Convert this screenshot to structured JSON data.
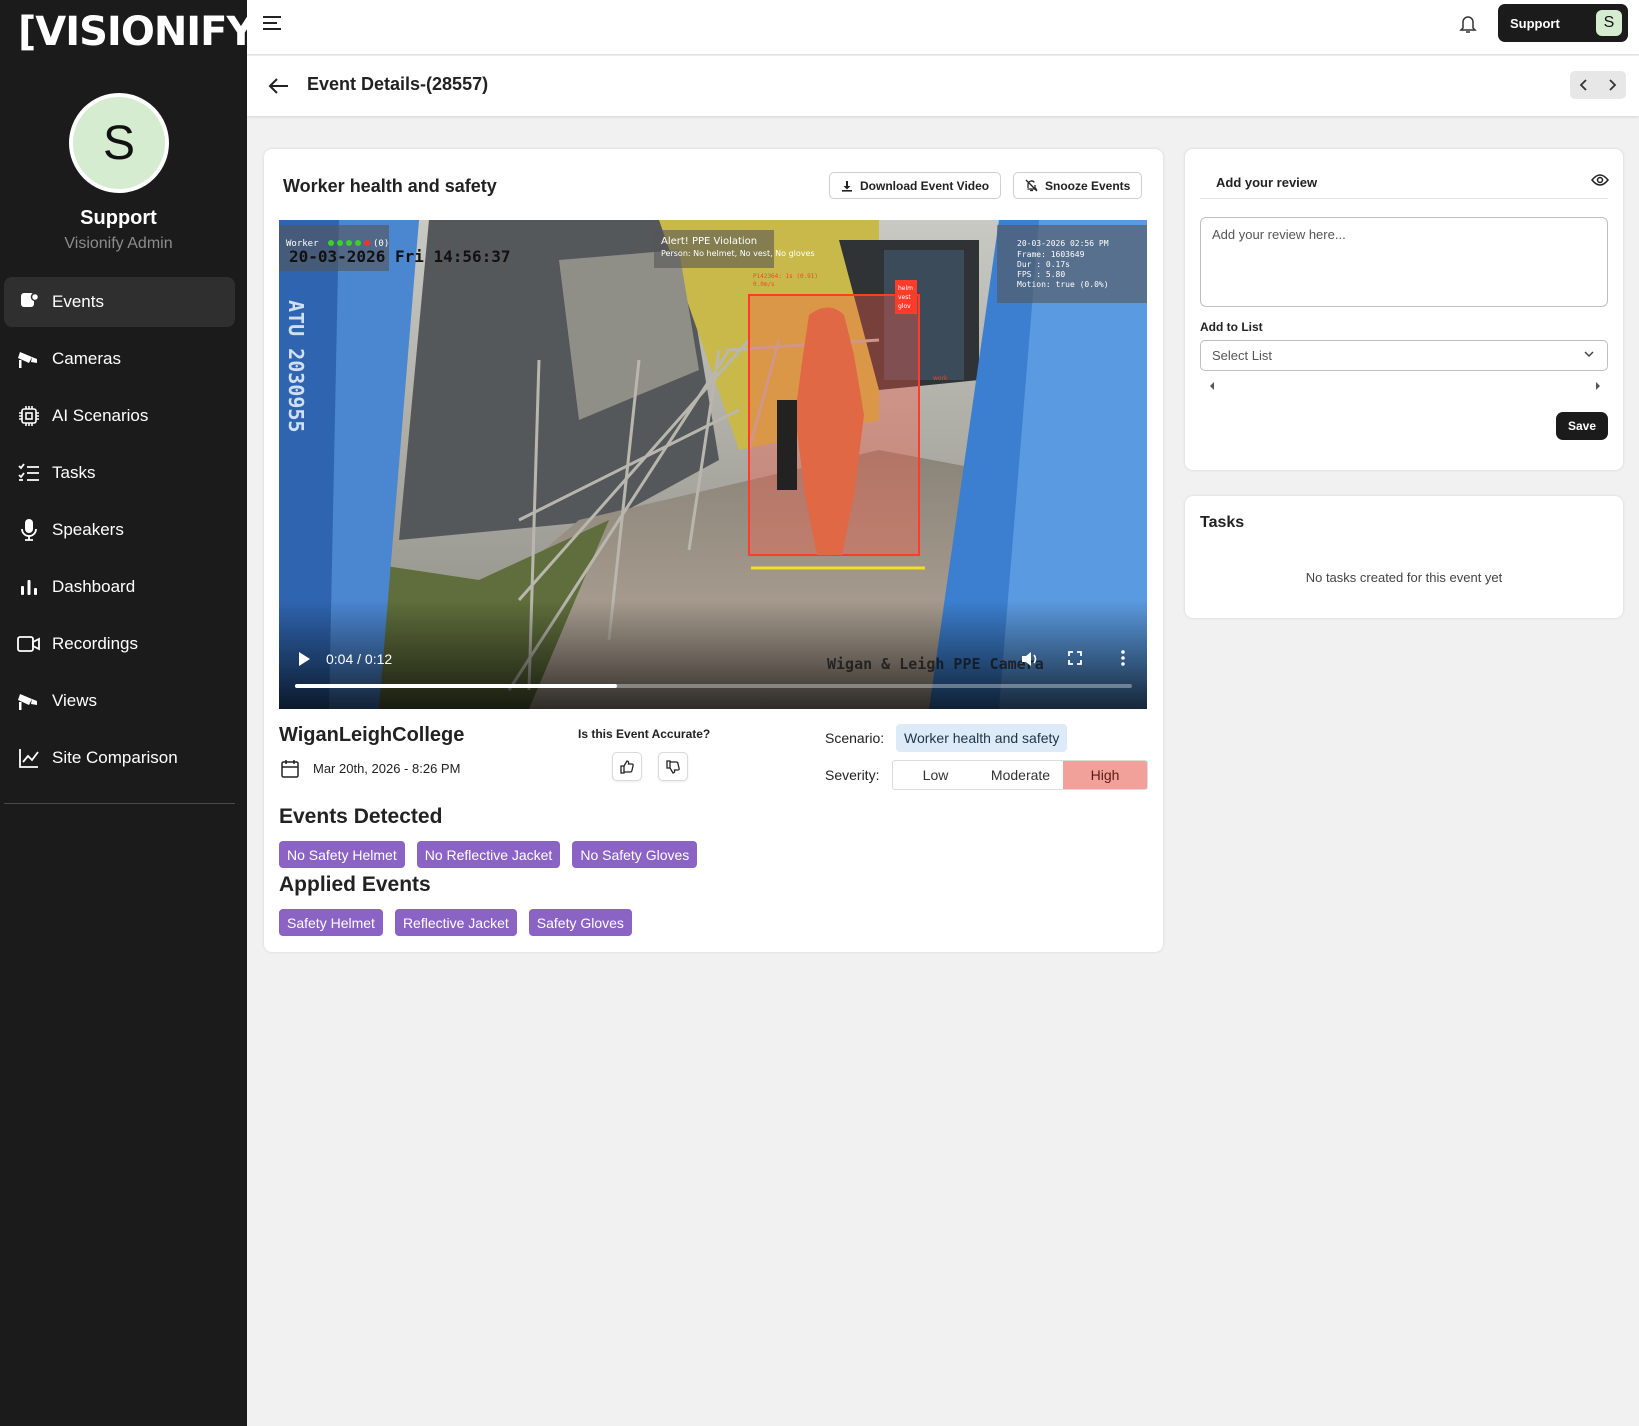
{
  "brand": {
    "logo_text": "[VISIONIFY]"
  },
  "user": {
    "initial": "S",
    "name": "Support",
    "role": "Visionify Admin"
  },
  "sidebar": {
    "items": [
      {
        "label": "Events",
        "icon": "events-icon",
        "active": true
      },
      {
        "label": "Cameras",
        "icon": "camera-icon"
      },
      {
        "label": "AI Scenarios",
        "icon": "chip-icon"
      },
      {
        "label": "Tasks",
        "icon": "task-list-icon"
      },
      {
        "label": "Speakers",
        "icon": "microphone-icon"
      },
      {
        "label": "Dashboard",
        "icon": "bar-chart-icon"
      },
      {
        "label": "Recordings",
        "icon": "video-camera-icon"
      },
      {
        "label": "Views",
        "icon": "camera-icon"
      },
      {
        "label": "Site Comparison",
        "icon": "line-chart-icon"
      }
    ]
  },
  "topbar": {
    "support_label": "Support",
    "support_initial": "S"
  },
  "header": {
    "title": "Event Details-(28557)"
  },
  "event": {
    "title": "Worker health and safety",
    "download_label": "Download Event Video",
    "snooze_label": "Snooze Events",
    "site": "WiganLeighCollege",
    "date": "Mar 20th, 2026 - 8:26 PM",
    "accurate_question": "Is this Event Accurate?",
    "scenario_label": "Scenario:",
    "scenario_value": "Worker health and safety",
    "severity_label": "Severity:",
    "severity_options": [
      "Low",
      "Moderate",
      "High"
    ],
    "severity_selected": "High",
    "events_detected_title": "Events Detected",
    "events_detected": [
      "No Safety Helmet",
      "No Reflective Jacket",
      "No Safety Gloves"
    ],
    "applied_events_title": "Applied Events",
    "applied_events": [
      "Safety Helmet",
      "Reflective Jacket",
      "Safety Gloves"
    ]
  },
  "video": {
    "time": "0:04 / 0:12",
    "progress": 0.385,
    "overlay_worker": "Worker",
    "overlay_counter": "(0)",
    "overlay_timestamp": "20-03-2026 Fri 14:56:37",
    "overlay_alert": "Alert! PPE Violation",
    "overlay_alert_detail": "Person: No helmet, No vest, No gloves",
    "overlay_box_id": "P142364: 1s (0.91)",
    "overlay_box_speed": "0.0m/s",
    "overlay_box_tags": [
      "helm",
      "vest",
      "glov"
    ],
    "overlay_box_work": "work",
    "overlay_stats": [
      "20-03-2026 02:56 PM",
      "Frame: 1603649",
      "Dur  : 0.17s",
      "FPS  : 5.80",
      "Motion: true (0.0%)"
    ],
    "overlay_camera_name": "Wigan & Leigh PPE Camera",
    "overlay_pole_text": "ATU 2030955"
  },
  "review": {
    "title": "Add your review",
    "placeholder": "Add your review here...",
    "list_label": "Add to List",
    "select_placeholder": "Select List",
    "save_label": "Save"
  },
  "tasks": {
    "title": "Tasks",
    "empty": "No tasks created for this event yet"
  },
  "colors": {
    "sidebar": "#1b1b1b",
    "tag": "#8a63c5",
    "severity_high": "#f2a19a",
    "scenario_chip": "#dcebf7"
  }
}
